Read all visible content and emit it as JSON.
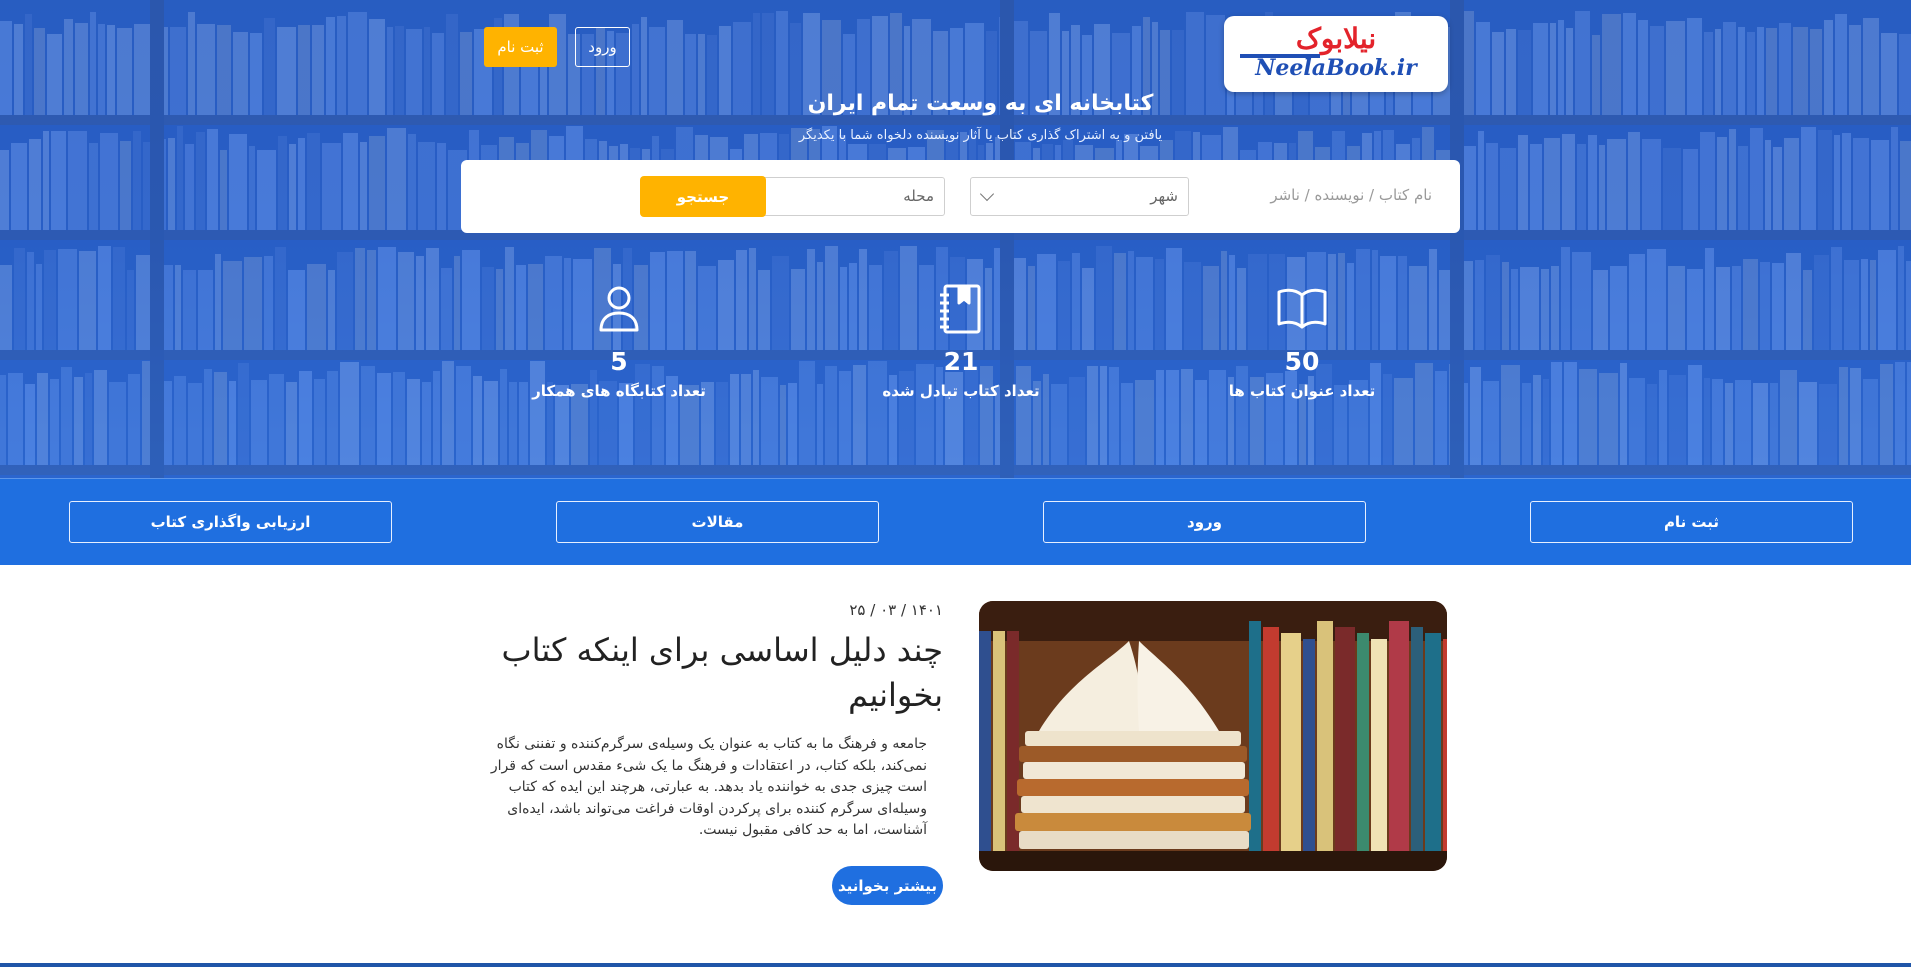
{
  "header": {
    "logo_fa": "نیلابوک",
    "logo_en": "NeelaBook.ir",
    "login_label": "ورود",
    "register_label": "ثبت نام"
  },
  "hero": {
    "title": "کتابخانه ای به وسعت تمام ایران",
    "subtitle": "یافتن و به اشتراک گذاری کتاب یا آثار نویسنده دلخواه شما با یکدیگر"
  },
  "search": {
    "input_placeholder": "نام کتاب / نویسنده / ناشر",
    "city_select": "شهر",
    "area_select": "محله",
    "button_label": "جستجو"
  },
  "stats": [
    {
      "icon": "open-book-icon",
      "value": "50",
      "label": "تعداد عنوان کتاب ها"
    },
    {
      "icon": "notebook-icon",
      "value": "21",
      "label": "تعداد کتاب تبادل شده"
    },
    {
      "icon": "user-icon",
      "value": "5",
      "label": "تعداد کتابگاه های همکار"
    }
  ],
  "nav": [
    {
      "label": "ثبت نام"
    },
    {
      "label": "ورود"
    },
    {
      "label": "مقالات"
    },
    {
      "label": "ارزیابی واگذاری کتاب"
    }
  ],
  "article": {
    "date": "۲۵ / ۰۳ / ۱۴۰۱",
    "title": "چند دلیل اساسی برای اینکه کتاب بخوانیم",
    "body": "جامعه و فرهنگ ما به کتاب به عنوان یک وسیله‌ی سرگرم‌کننده و تفننی نگاه نمی‌کند، بلکه کتاب، در اعتقادات و فرهنگ ما یک شیء مقدس است که قرار است چیزی جدی به خواننده یاد بدهد. به عبارتی، هرچند این ایده که کتاب وسیله‌ای سرگرم کننده برای پرکردن اوقات فراغت می‌تواند باشد، ایده‌ای آشناست، اما به حد کافی مقبول نیست.",
    "read_more": "بیشتر بخوانید"
  },
  "colors": {
    "primary": "#1f6fe0",
    "accent": "#ffb300",
    "hero": "#2f64c6"
  }
}
